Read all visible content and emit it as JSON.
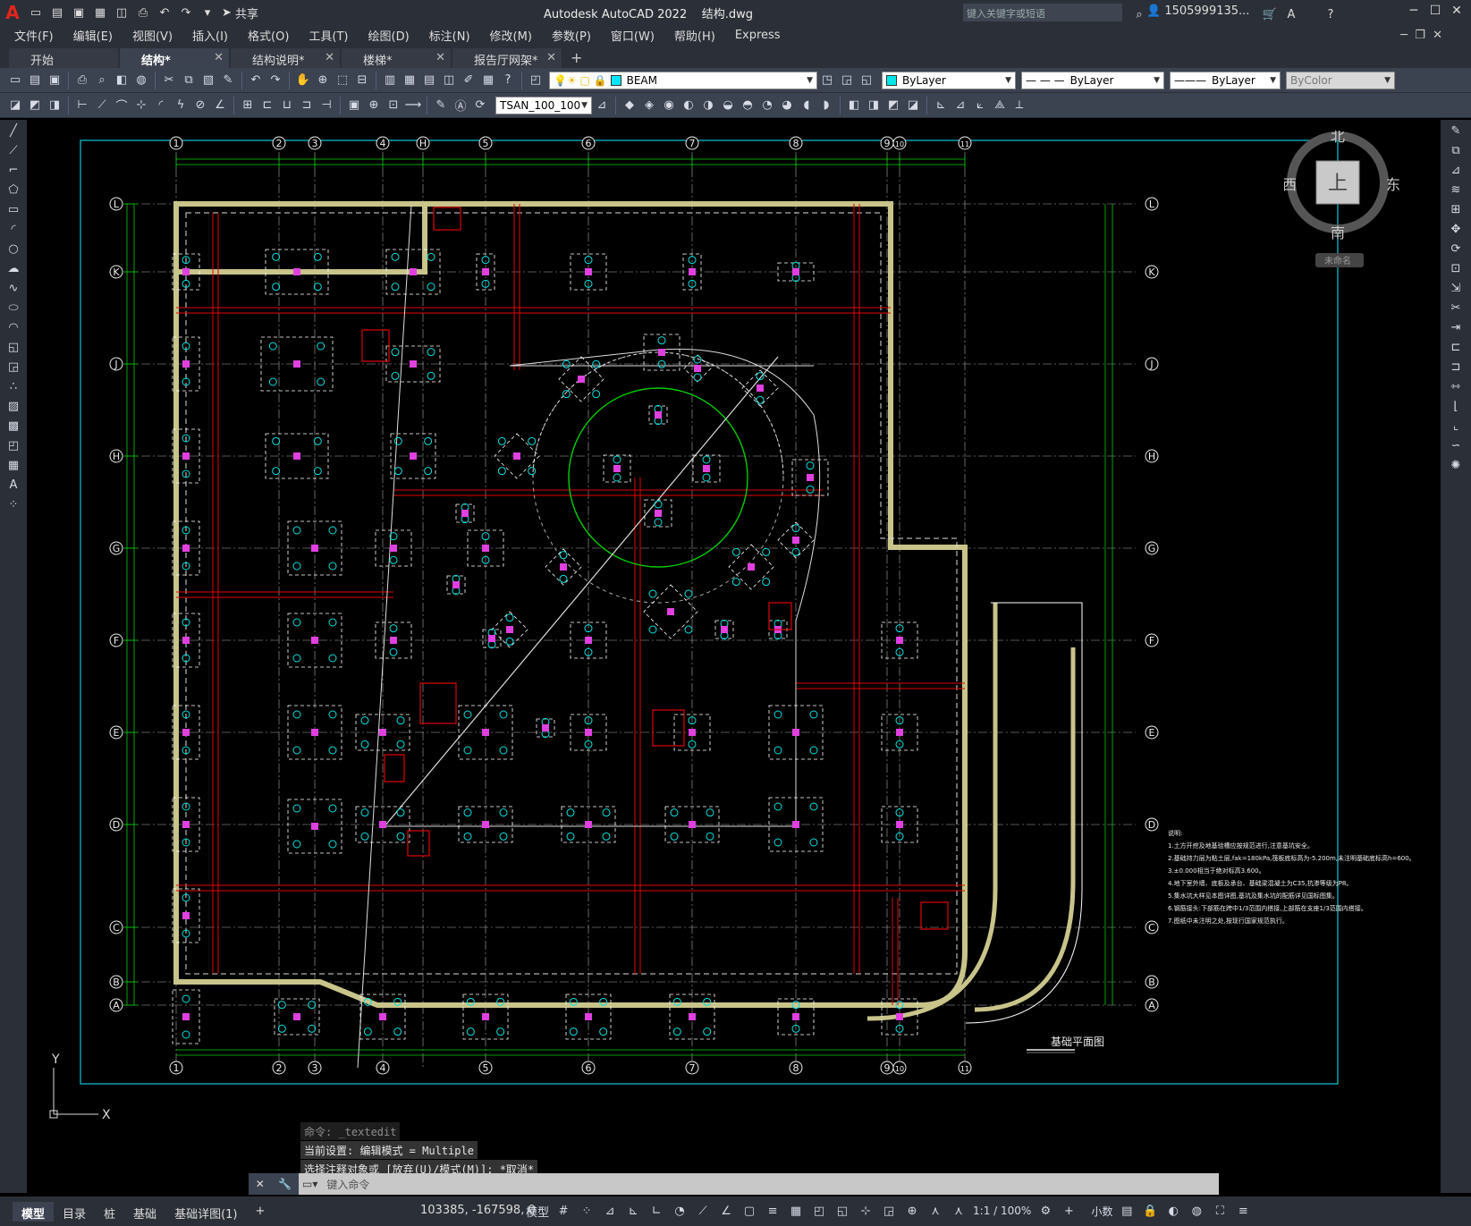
{
  "app": {
    "title": "Autodesk AutoCAD 2022",
    "file": "结构.dwg",
    "search_placeholder": "键入关键字或短语",
    "user": "1505999135...",
    "share": "共享"
  },
  "menu": [
    "文件(F)",
    "编辑(E)",
    "视图(V)",
    "插入(I)",
    "格式(O)",
    "工具(T)",
    "绘图(D)",
    "标注(N)",
    "修改(M)",
    "参数(P)",
    "窗口(W)",
    "帮助(H)",
    "Express"
  ],
  "tabs": [
    {
      "label": "开始",
      "active": false
    },
    {
      "label": "结构*",
      "active": true
    },
    {
      "label": "结构说明*",
      "active": false
    },
    {
      "label": "楼梯*",
      "active": false
    },
    {
      "label": "报告厅网架*",
      "active": false
    }
  ],
  "layer_toolbar": {
    "layer": "BEAM",
    "layer_color": "#00e5ff",
    "color": "ByLayer",
    "linetype": "ByLayer",
    "lineweight": "ByLayer",
    "plotstyle": "ByColor"
  },
  "dim_toolbar": {
    "dimstyle": "TSAN_100_100"
  },
  "viewcube": {
    "north": "北",
    "south": "南",
    "east": "东",
    "west": "西",
    "top": "上",
    "ucs": "未命名"
  },
  "drawing": {
    "grid_top": [
      "1",
      "2",
      "3",
      "4",
      "H",
      "5",
      "6",
      "7",
      "8",
      "9",
      "10",
      "11"
    ],
    "grid_bottom": [
      "1",
      "2",
      "3",
      "4",
      "5",
      "6",
      "7",
      "8",
      "9",
      "10",
      "11"
    ],
    "grid_rows": [
      "L",
      "K",
      "J",
      "H",
      "G",
      "F",
      "E",
      "D",
      "C",
      "B",
      "A"
    ],
    "plan_title": "基础平面图",
    "notes_heading": "说明:",
    "notes": [
      "1.土方开挖及地基验槽应按规范进行,注意基坑安全。",
      "2.基础持力层为粘土层,fak=180kPa,筏板底标高为-5.200m,未注明基础底标高h=600。",
      "3.±0.000相当于绝对标高3.600。",
      "4.地下室外墙、底板及承台、基础梁混凝土为C35,抗渗等级为P8。",
      "5.集水坑大样见本图详图,基坑及集水坑的配筋详见国标图集。",
      "6.钢筋接头:下部筋在跨中1/3范围内搭接,上部筋在支座1/3范围内搭接。",
      "7.图纸中未注明之处,按现行国家规范执行。"
    ],
    "axis_y": "Y",
    "axis_x": "X"
  },
  "command": {
    "history": [
      "命令: _textedit",
      "当前设置: 编辑模式 = Multiple",
      "选择注释对象或 [放弃(U)/模式(M)]: *取消*"
    ],
    "placeholder": "键入命令"
  },
  "status": {
    "layouts": [
      "模型",
      "目录",
      "桩",
      "基础",
      "基础详图(1)"
    ],
    "coords": "103385, -167598, 0",
    "mode": "模型",
    "scale": "1:1 / 100%",
    "units": "小数"
  }
}
